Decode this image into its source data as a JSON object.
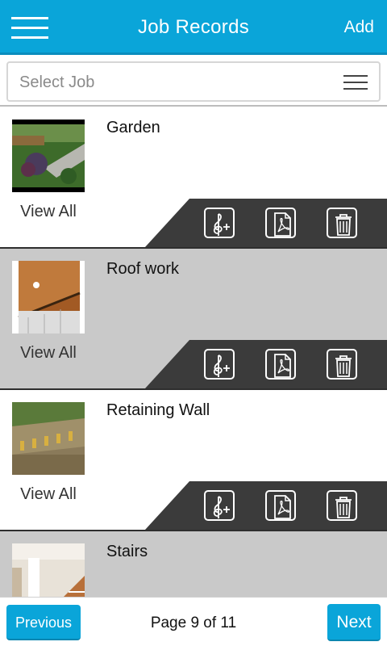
{
  "header": {
    "title": "Job Records",
    "add_label": "Add"
  },
  "filter": {
    "select_placeholder": "Select Job"
  },
  "jobs": [
    {
      "title": "Garden",
      "view_all_label": "View All"
    },
    {
      "title": "Roof work",
      "view_all_label": "View All"
    },
    {
      "title": "Retaining Wall",
      "view_all_label": "View All"
    },
    {
      "title": "Stairs"
    }
  ],
  "footer": {
    "previous_label": "Previous",
    "page_text": "Page 9 of 11",
    "next_label": "Next"
  },
  "colors": {
    "accent": "#0aa5d9",
    "row_alt": "#c9c9c9",
    "action_bar": "#3b3b3b"
  },
  "icons": {
    "menu": "hamburger-icon",
    "list": "list-icon",
    "audio": "treble-clef-plus-icon",
    "pdf": "pdf-icon",
    "delete": "trash-icon"
  }
}
